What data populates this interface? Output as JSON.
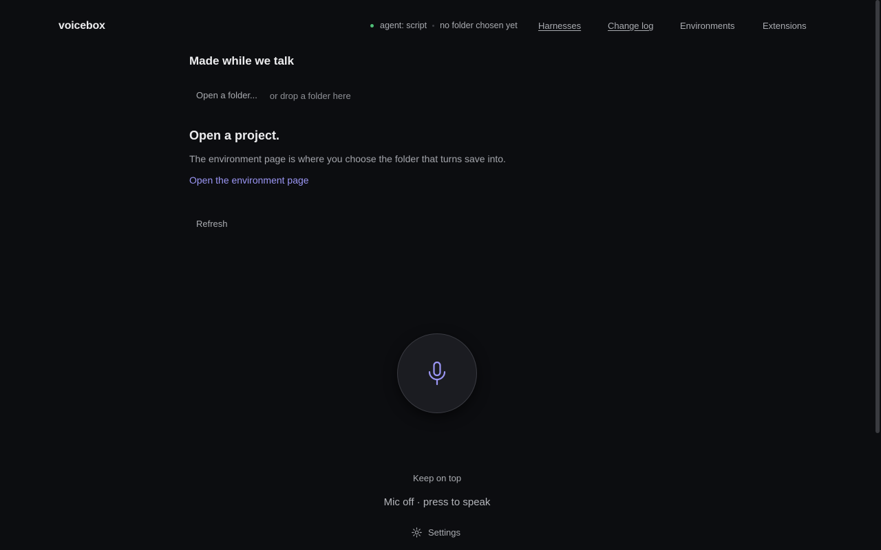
{
  "header": {
    "brand": "voicebox",
    "status": {
      "agent": "agent: script",
      "folder": "no folder chosen yet",
      "dot_color": "#4fbf77"
    },
    "nav": {
      "harnesses": "Harnesses",
      "changelog": "Change log",
      "environments": "Environments",
      "extensions": "Extensions"
    }
  },
  "main": {
    "made_title": "Made while we talk",
    "open_folder_label": "Open a folder...",
    "drop_hint": "or drop a folder here",
    "project_title": "Open a project.",
    "project_desc": "The environment page is where you choose the folder that turns save into.",
    "env_link": "Open the environment page",
    "refresh_label": "Refresh"
  },
  "mic": {
    "icon": "microphone-icon",
    "accent": "#9b96f5",
    "keep_on_top": "Keep on top",
    "status": "Mic off · press to speak"
  },
  "footer": {
    "settings_label": "Settings",
    "settings_icon": "gear-icon"
  }
}
